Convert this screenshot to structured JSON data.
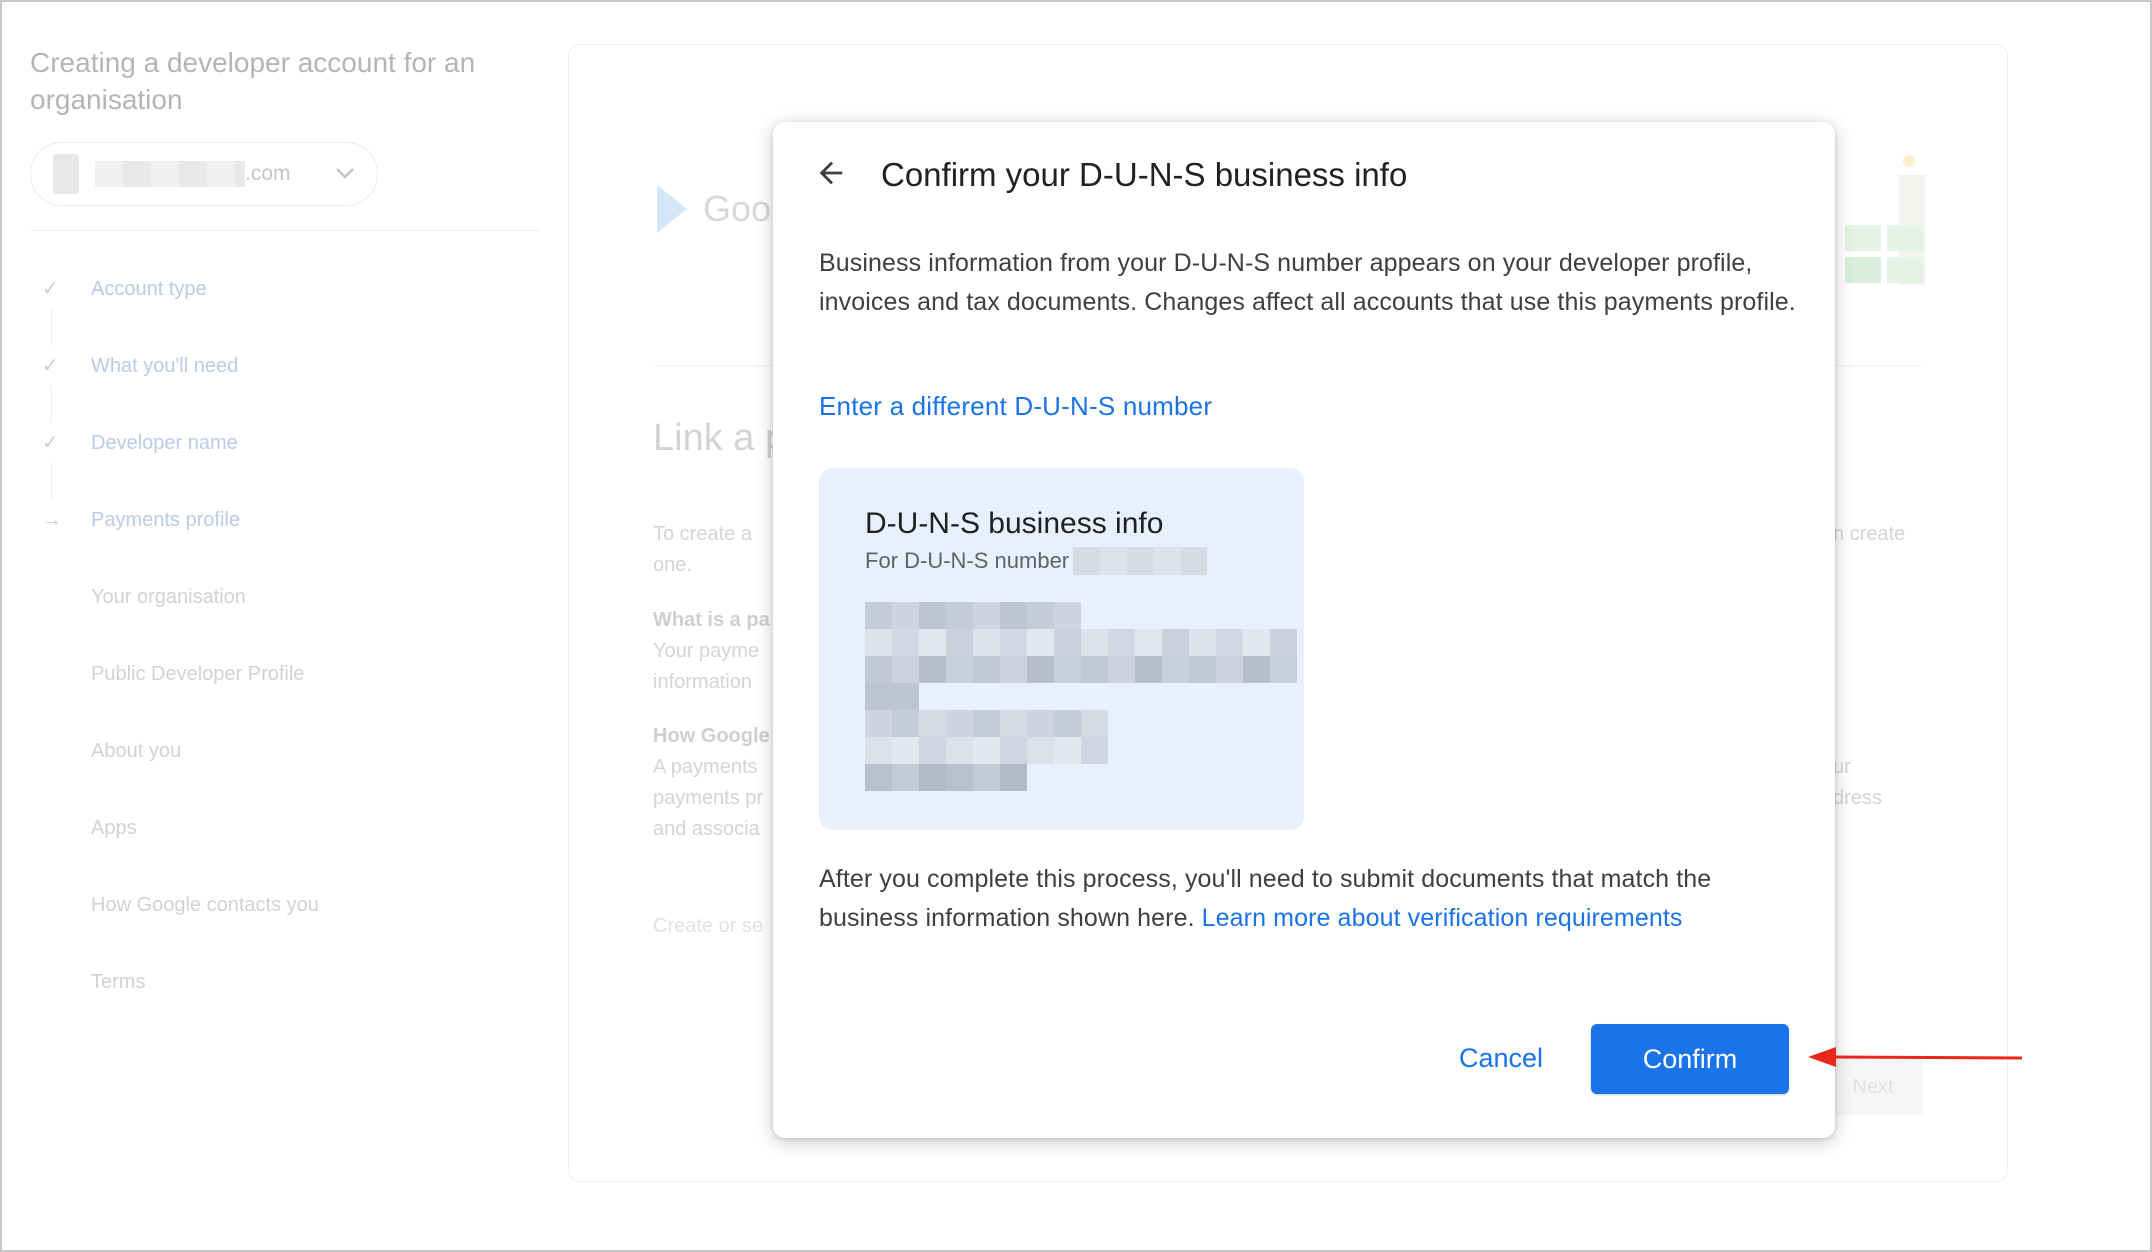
{
  "background": {
    "page_title": "Creating a developer account for an organisation",
    "account": {
      "domain_suffix": ".com"
    },
    "steps": [
      {
        "label": "Account type",
        "mark": "✓"
      },
      {
        "label": "What you'll need",
        "mark": "✓"
      },
      {
        "label": "Developer name",
        "mark": "✓"
      },
      {
        "label": "Payments profile",
        "mark": "→"
      },
      {
        "label": "Your organisation",
        "mark": ""
      },
      {
        "label": "Public Developer Profile",
        "mark": ""
      },
      {
        "label": "About you",
        "mark": ""
      },
      {
        "label": "Apps",
        "mark": ""
      },
      {
        "label": "How Google contacts you",
        "mark": ""
      },
      {
        "label": "Terms",
        "mark": ""
      }
    ],
    "card": {
      "logo_text": "Goo",
      "heading": "Link a p",
      "intro_line1": "To create a",
      "intro_line2": "one.",
      "intro_right": "n create",
      "q1_title": "What is a pa",
      "q1_line1": "Your payme",
      "q1_line2": "information",
      "q2_title": "How Google",
      "q2_line1": "A payments",
      "q2_line2": "payments pr",
      "q2_line3": "and associa",
      "q2_right1": "ur",
      "q2_right2": "dress",
      "create_link": "Create or se",
      "next_label": "Next"
    }
  },
  "dialog": {
    "title": "Confirm your D-U-N-S business info",
    "description": "Business information from your D-U-N-S number appears on your developer profile, invoices and tax documents. Changes affect all accounts that use this payments profile.",
    "alt_link": "Enter a different D-U-N-S number",
    "card": {
      "title": "D-U-N-S business info",
      "subtitle": "For D-U-N-S number"
    },
    "after_text": "After you complete this process, you'll need to submit documents that match the business information shown here.",
    "learn_link": "Learn more about verification requirements",
    "cancel_label": "Cancel",
    "confirm_label": "Confirm"
  },
  "colors": {
    "primary": "#1a73e8",
    "card_bg": "#e8f0fe",
    "annotation": "#e8271b"
  }
}
